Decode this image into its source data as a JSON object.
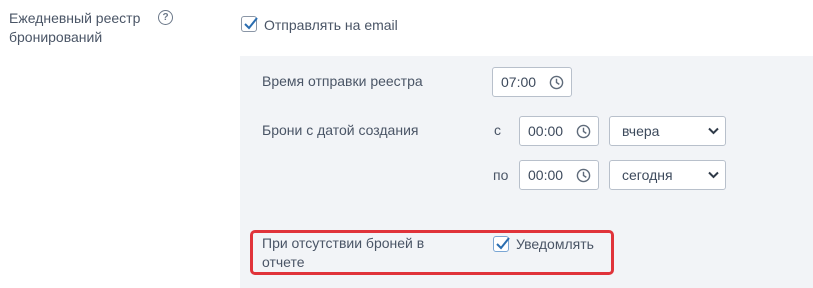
{
  "daily_register": {
    "label": "Ежедневный реестр бронирований",
    "help_icon": "question-circle-icon",
    "send_email_checked": true,
    "send_email_label": "Отправлять на email"
  },
  "settings": {
    "send_time_label": "Время отправки реестра",
    "send_time_value": "07:00",
    "created_date_label": "Брони с датой создания",
    "from_label": "с",
    "from_time": "00:00",
    "from_day": "вчера",
    "to_label": "по",
    "to_time": "00:00",
    "to_day": "сегодня",
    "no_bookings_label": "При отсутствии броней в отчете",
    "notify_checked": true,
    "notify_label": "Уведомлять"
  },
  "colors": {
    "highlight": "#e0333a",
    "check": "#2a6db0",
    "panel_bg": "#f2f4f7"
  }
}
